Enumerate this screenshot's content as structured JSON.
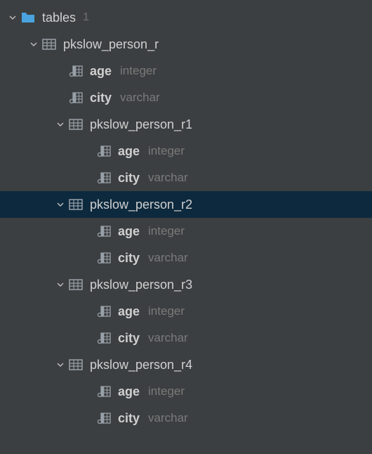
{
  "folder": {
    "name": "tables",
    "count": "1"
  },
  "tables": {
    "root": {
      "name": "pkslow_person_r",
      "columns": [
        {
          "name": "age",
          "type": "integer"
        },
        {
          "name": "city",
          "type": "varchar"
        }
      ],
      "children": [
        {
          "name": "pkslow_person_r1",
          "columns": [
            {
              "name": "age",
              "type": "integer"
            },
            {
              "name": "city",
              "type": "varchar"
            }
          ],
          "selected": false
        },
        {
          "name": "pkslow_person_r2",
          "columns": [
            {
              "name": "age",
              "type": "integer"
            },
            {
              "name": "city",
              "type": "varchar"
            }
          ],
          "selected": true
        },
        {
          "name": "pkslow_person_r3",
          "columns": [
            {
              "name": "age",
              "type": "integer"
            },
            {
              "name": "city",
              "type": "varchar"
            }
          ],
          "selected": false
        },
        {
          "name": "pkslow_person_r4",
          "columns": [
            {
              "name": "age",
              "type": "integer"
            },
            {
              "name": "city",
              "type": "varchar"
            }
          ],
          "selected": false
        }
      ]
    }
  }
}
